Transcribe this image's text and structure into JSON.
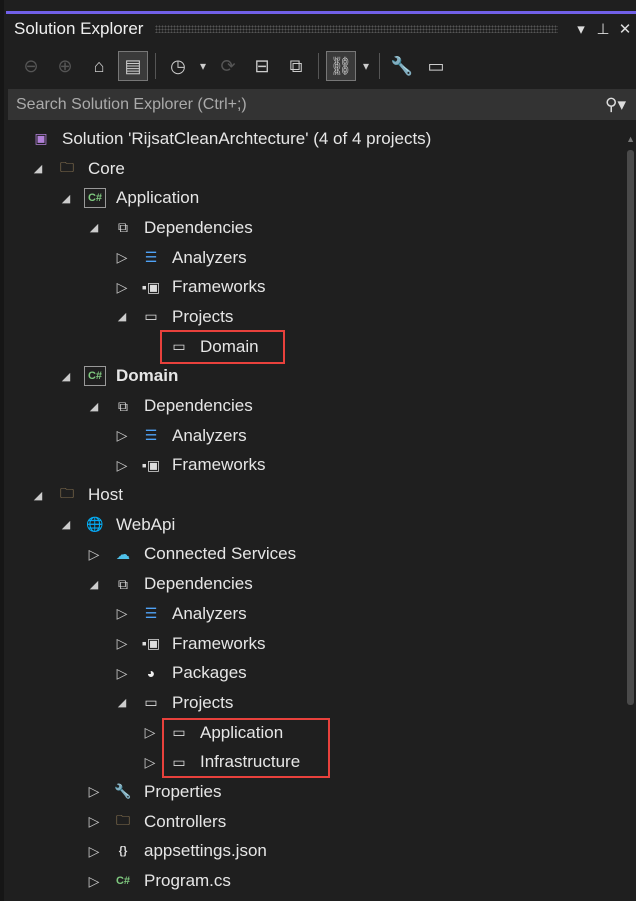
{
  "panel": {
    "title": "Solution Explorer",
    "dropdown_icon": "▾",
    "pin_icon": "📌",
    "close_icon": "✕"
  },
  "toolbar": [
    {
      "name": "back-button",
      "glyph": "⊖",
      "dim": true
    },
    {
      "name": "forward-button",
      "glyph": "⊕",
      "dim": true
    },
    {
      "name": "home-button",
      "glyph": "⌂"
    },
    {
      "name": "switch-views-button",
      "glyph": "▤",
      "sel": true
    },
    {
      "sep": true
    },
    {
      "name": "pending-changes-filter-button",
      "glyph": "◷"
    },
    {
      "name": "filter-dropdown",
      "glyph": "▾"
    },
    {
      "name": "sync-button",
      "glyph": "⟳",
      "dim": true
    },
    {
      "name": "collapse-all-button",
      "glyph": "⊟"
    },
    {
      "name": "show-all-files-button",
      "glyph": "⧉"
    },
    {
      "sep": true
    },
    {
      "name": "view-hierarchy-button",
      "glyph": "⛓",
      "sel": true
    },
    {
      "name": "view-dropdown",
      "glyph": "▾"
    },
    {
      "sep": true
    },
    {
      "name": "properties-button",
      "glyph": "🔧"
    },
    {
      "name": "preview-button",
      "glyph": "▭"
    }
  ],
  "search": {
    "placeholder": "Search Solution Explorer (Ctrl+;)"
  },
  "tree": [
    {
      "label": "Solution 'RijsatCleanArchtecture' (4 of 4 projects)",
      "level": 0,
      "toggle": "",
      "icon": "solution",
      "glyph": "▣",
      "color": "#b180d7"
    },
    {
      "label": "Core",
      "level": 1,
      "toggle": "expanded",
      "icon": "folder",
      "glyph": "🗀",
      "color": "#dcb67a"
    },
    {
      "label": "Application",
      "level": 2,
      "toggle": "expanded",
      "icon": "csharp-project",
      "glyph": "C#",
      "color": "#7fc97f"
    },
    {
      "label": "Dependencies",
      "level": 3,
      "toggle": "expanded",
      "icon": "dependencies",
      "glyph": "⧉",
      "color": "#ddd"
    },
    {
      "label": "Analyzers",
      "level": 4,
      "toggle": "collapsed",
      "icon": "analyzers",
      "glyph": "☰",
      "color": "#4fa3f7"
    },
    {
      "label": "Frameworks",
      "level": 4,
      "toggle": "collapsed",
      "icon": "frameworks",
      "glyph": "▪▣",
      "color": "#ddd"
    },
    {
      "label": "Projects",
      "level": 4,
      "toggle": "expanded",
      "icon": "projects",
      "glyph": "▭",
      "color": "#ddd"
    },
    {
      "label": "Domain",
      "level": 5,
      "toggle": "",
      "icon": "project-reference",
      "glyph": "▭",
      "color": "#ddd"
    },
    {
      "label": "Domain",
      "level": 2,
      "toggle": "expanded",
      "icon": "csharp-project",
      "glyph": "C#",
      "color": "#7fc97f",
      "bold": true
    },
    {
      "label": "Dependencies",
      "level": 3,
      "toggle": "expanded",
      "icon": "dependencies",
      "glyph": "⧉",
      "color": "#ddd"
    },
    {
      "label": "Analyzers",
      "level": 4,
      "toggle": "collapsed",
      "icon": "analyzers",
      "glyph": "☰",
      "color": "#4fa3f7"
    },
    {
      "label": "Frameworks",
      "level": 4,
      "toggle": "collapsed",
      "icon": "frameworks",
      "glyph": "▪▣",
      "color": "#ddd"
    },
    {
      "label": "Host",
      "level": 1,
      "toggle": "expanded",
      "icon": "folder",
      "glyph": "🗀",
      "color": "#dcb67a"
    },
    {
      "label": "WebApi",
      "level": 2,
      "toggle": "expanded",
      "icon": "web-project",
      "glyph": "🌐",
      "color": "#4fa3f7"
    },
    {
      "label": "Connected Services",
      "level": 3,
      "toggle": "collapsed",
      "icon": "connected-services",
      "glyph": "☁",
      "color": "#4fc1e9"
    },
    {
      "label": "Dependencies",
      "level": 3,
      "toggle": "expanded",
      "icon": "dependencies",
      "glyph": "⧉",
      "color": "#ddd"
    },
    {
      "label": "Analyzers",
      "level": 4,
      "toggle": "collapsed",
      "icon": "analyzers",
      "glyph": "☰",
      "color": "#4fa3f7"
    },
    {
      "label": "Frameworks",
      "level": 4,
      "toggle": "collapsed",
      "icon": "frameworks",
      "glyph": "▪▣",
      "color": "#ddd"
    },
    {
      "label": "Packages",
      "level": 4,
      "toggle": "collapsed",
      "icon": "packages",
      "glyph": "◕",
      "color": "#eee"
    },
    {
      "label": "Projects",
      "level": 4,
      "toggle": "expanded",
      "icon": "projects",
      "glyph": "▭",
      "color": "#ddd"
    },
    {
      "label": "Application",
      "level": 5,
      "toggle": "collapsed",
      "icon": "project-reference",
      "glyph": "▭",
      "color": "#ddd"
    },
    {
      "label": "Infrastructure",
      "level": 5,
      "toggle": "collapsed",
      "icon": "project-reference",
      "glyph": "▭",
      "color": "#ddd"
    },
    {
      "label": "Properties",
      "level": 3,
      "toggle": "collapsed",
      "icon": "properties",
      "glyph": "🔧",
      "color": "#ddd"
    },
    {
      "label": "Controllers",
      "level": 3,
      "toggle": "collapsed",
      "icon": "folder",
      "glyph": "🗀",
      "color": "#dcb67a"
    },
    {
      "label": "appsettings.json",
      "level": 3,
      "toggle": "collapsed",
      "icon": "json-file",
      "glyph": "{}",
      "color": "#ddd"
    },
    {
      "label": "Program.cs",
      "level": 3,
      "toggle": "collapsed",
      "icon": "csharp-file",
      "glyph": "C#",
      "color": "#7fc97f"
    }
  ],
  "highlight_color": "#e8413c"
}
